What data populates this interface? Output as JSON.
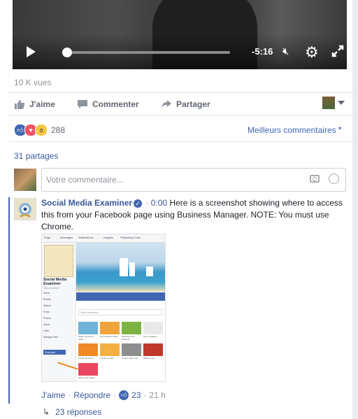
{
  "video": {
    "time_remaining": "-5:16",
    "progress": 0.0
  },
  "post": {
    "views": "10 K vues",
    "actions": {
      "like": "J'aime",
      "comment": "Commenter",
      "share": "Partager"
    },
    "reaction_count": "288",
    "sort_label": "Meilleurs commentaires",
    "shares": "31 partages"
  },
  "composer": {
    "placeholder": "Votre commentaire..."
  },
  "comment": {
    "author": "Social Media Examiner",
    "timestamp": "0:00",
    "text": "Here is a screenshot showing where to access this from your Facebook page using Business Manager. NOTE: You must use Chrome.",
    "like_label": "J'aime",
    "reply_label": "Répondre",
    "like_count": "23",
    "age": "21 h",
    "replies": "23 réponses"
  },
  "screenshot": {
    "tabs": [
      "Page",
      "Messages",
      "Notifications",
      "Insights",
      "Publishing Tools"
    ],
    "page_name": "Social Media Examiner",
    "handle": "@smexaminer",
    "menu": [
      "Home",
      "Events",
      "Videos",
      "Posts",
      "Photos",
      "About",
      "Likes",
      "Manage Tabs"
    ],
    "promote": "Promote",
    "write_placeholder": "Write something...",
    "tile_labels": [
      "Share a photo or video",
      "Get people to book",
      "Advertise your business",
      "Get messages",
      "Create an event",
      "Create an offer",
      "Create a job post",
      "Write a note",
      "Start a Live Video"
    ]
  }
}
